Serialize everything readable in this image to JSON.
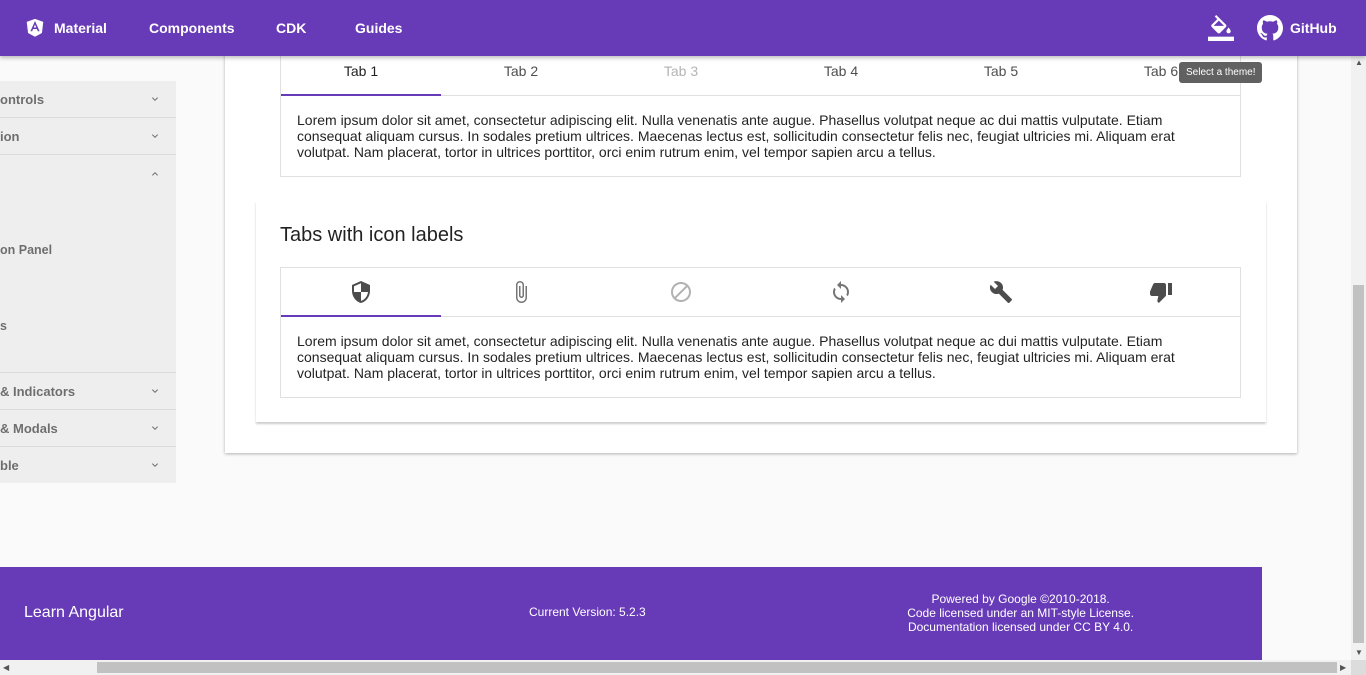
{
  "header": {
    "brand": "Material",
    "nav": [
      "Components",
      "CDK",
      "Guides"
    ],
    "github": "GitHub",
    "tooltip": "Select a theme!"
  },
  "sidebar": {
    "categories": [
      {
        "label": "ontrols",
        "expanded": false
      },
      {
        "label": "ion",
        "expanded": false
      },
      {
        "label": "",
        "expanded": true
      },
      {
        "label": "& Indicators",
        "expanded": false
      },
      {
        "label": "& Modals",
        "expanded": false
      },
      {
        "label": "ble",
        "expanded": false
      }
    ],
    "sub_items": [
      "on Panel",
      "s"
    ]
  },
  "tabs_basic": {
    "tabs": [
      "Tab 1",
      "Tab 2",
      "Tab 3",
      "Tab 4",
      "Tab 5",
      "Tab 6"
    ],
    "active_index": 0,
    "disabled_index": 2,
    "content": "Lorem ipsum dolor sit amet, consectetur adipiscing elit. Nulla venenatis ante augue. Phasellus volutpat neque ac dui mattis vulputate. Etiam consequat aliquam cursus. In sodales pretium ultrices. Maecenas lectus est, sollicitudin consectetur felis nec, feugiat ultricies mi. Aliquam erat volutpat. Nam placerat, tortor in ultrices porttitor, orci enim rutrum enim, vel tempor sapien arcu a tellus."
  },
  "tabs_icons": {
    "title": "Tabs with icon labels",
    "icons": [
      "security-icon",
      "attachment-icon",
      "block-icon",
      "sync-icon",
      "build-icon",
      "thumb-down-icon"
    ],
    "active_index": 0,
    "disabled_index": 2,
    "content": "Lorem ipsum dolor sit amet, consectetur adipiscing elit. Nulla venenatis ante augue. Phasellus volutpat neque ac dui mattis vulputate. Etiam consequat aliquam cursus. In sodales pretium ultrices. Maecenas lectus est, sollicitudin consectetur felis nec, feugiat ultricies mi. Aliquam erat volutpat. Nam placerat, tortor in ultrices porttitor, orci enim rutrum enim, vel tempor sapien arcu a tellus."
  },
  "footer": {
    "learn": "Learn Angular",
    "version": "Current Version: 5.2.3",
    "powered": "Powered by Google ©2010-2018.",
    "code_license": "Code licensed under an MIT-style License.",
    "doc_license": "Documentation licensed under CC BY 4.0."
  },
  "colors": {
    "primary": "#673ab7",
    "background": "#fafafa",
    "sidebar": "#eeeeee"
  }
}
